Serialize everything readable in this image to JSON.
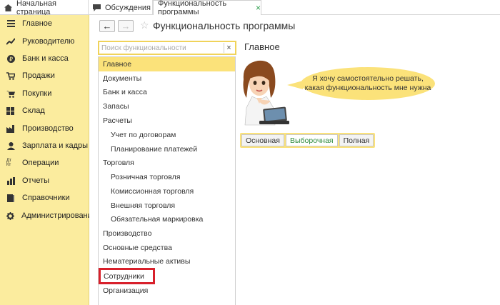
{
  "tabs": [
    {
      "label": "Начальная страница",
      "icon": "home-icon"
    },
    {
      "label": "Обсуждения",
      "icon": "chat-icon"
    },
    {
      "label": "Функциональность программы",
      "close": "×"
    }
  ],
  "sidebar": {
    "items": [
      {
        "label": "Главное",
        "icon": "menu-icon"
      },
      {
        "label": "Руководителю",
        "icon": "trend-icon"
      },
      {
        "label": "Банк и касса",
        "icon": "bank-icon"
      },
      {
        "label": "Продажи",
        "icon": "cart-icon"
      },
      {
        "label": "Покупки",
        "icon": "purchase-cart-icon"
      },
      {
        "label": "Склад",
        "icon": "warehouse-icon"
      },
      {
        "label": "Производство",
        "icon": "factory-icon"
      },
      {
        "label": "Зарплата и кадры",
        "icon": "person-icon"
      },
      {
        "label": "Операции",
        "icon": "operations-icon",
        "icon_text": "Дт Кт"
      },
      {
        "label": "Отчеты",
        "icon": "bar-chart-icon"
      },
      {
        "label": "Справочники",
        "icon": "book-icon"
      },
      {
        "label": "Администрирование",
        "icon": "gear-icon"
      }
    ]
  },
  "toolbar": {
    "back": "←",
    "forward": "→",
    "star": "☆"
  },
  "page_title": "Функциональность программы",
  "search": {
    "placeholder": "Поиск функциональности",
    "clear": "×"
  },
  "list": {
    "items": [
      {
        "label": "Главное",
        "level": 0,
        "selected": true
      },
      {
        "label": "Документы",
        "level": 0
      },
      {
        "label": "Банк и касса",
        "level": 0
      },
      {
        "label": "Запасы",
        "level": 0
      },
      {
        "label": "Расчеты",
        "level": 0
      },
      {
        "label": "Учет по договорам",
        "level": 1
      },
      {
        "label": "Планирование платежей",
        "level": 1
      },
      {
        "label": "Торговля",
        "level": 0
      },
      {
        "label": "Розничная торговля",
        "level": 1
      },
      {
        "label": "Комиссионная торговля",
        "level": 1
      },
      {
        "label": "Внешняя торговля",
        "level": 1
      },
      {
        "label": "Обязательная маркировка",
        "level": 1
      },
      {
        "label": "Производство",
        "level": 0
      },
      {
        "label": "Основные средства",
        "level": 0
      },
      {
        "label": "Нематериальные активы",
        "level": 0
      },
      {
        "label": "Сотрудники",
        "level": 0,
        "highlighted": true
      },
      {
        "label": "Организация",
        "level": 0
      }
    ]
  },
  "section_title": "Главное",
  "bubble": {
    "line1": "Я хочу самостоятельно решать,",
    "line2": "какая функциональность мне нужна"
  },
  "mode_buttons": [
    {
      "label": "Основная",
      "active": false
    },
    {
      "label": "Выборочная",
      "active": true
    },
    {
      "label": "Полная",
      "active": false
    }
  ],
  "colors": {
    "sidebar_bg": "#fbec9e",
    "accent_yellow": "#fbe27a",
    "highlight_red": "#d8202b",
    "active_green": "#2e8b3e"
  }
}
